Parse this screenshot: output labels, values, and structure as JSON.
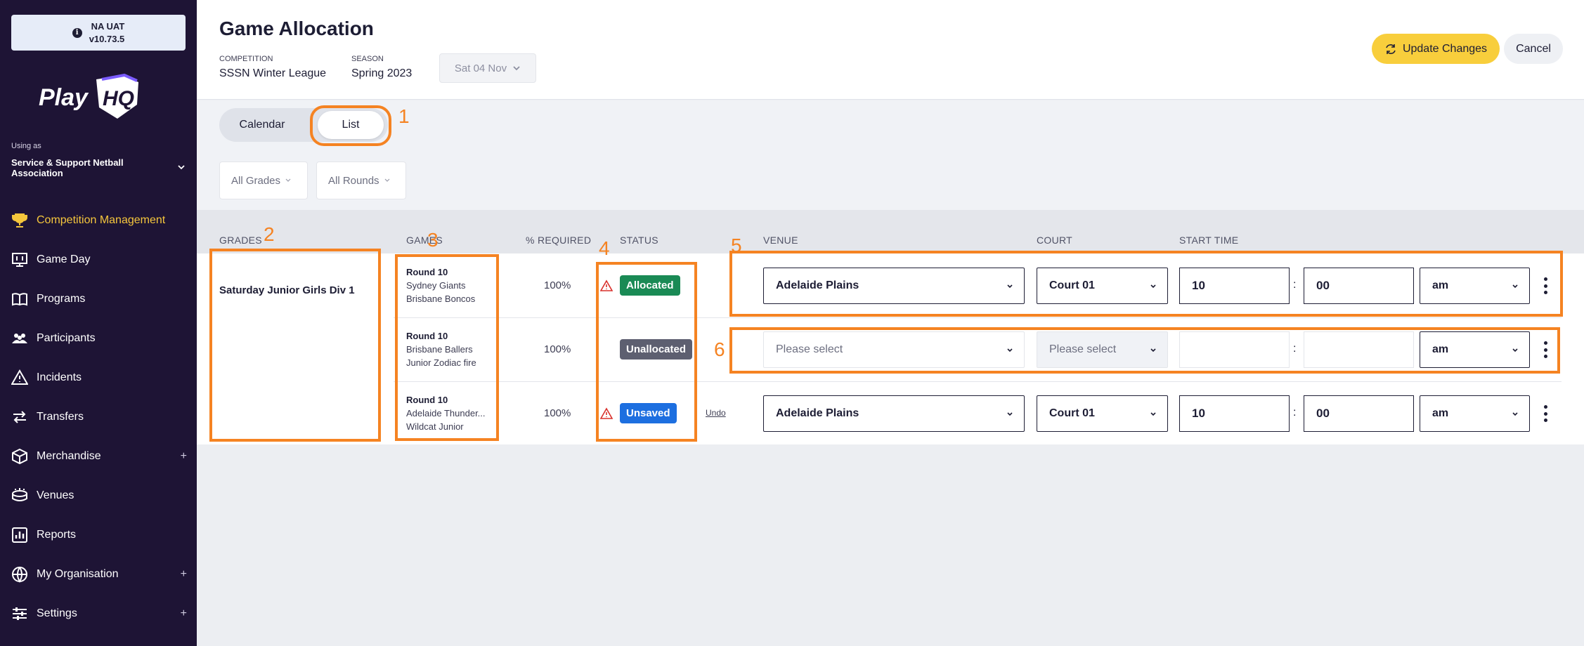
{
  "env": {
    "name": "NA UAT",
    "version": "v10.73.5"
  },
  "org": {
    "using_as": "Using as",
    "name": "Service & Support Netball Association"
  },
  "nav": [
    {
      "label": "Competition Management",
      "icon": "trophy-icon",
      "active": true,
      "plus": ""
    },
    {
      "label": "Game Day",
      "icon": "scoreboard-icon",
      "active": false,
      "plus": ""
    },
    {
      "label": "Programs",
      "icon": "book-icon",
      "active": false,
      "plus": ""
    },
    {
      "label": "Participants",
      "icon": "people-icon",
      "active": false,
      "plus": ""
    },
    {
      "label": "Incidents",
      "icon": "warning-icon",
      "active": false,
      "plus": ""
    },
    {
      "label": "Transfers",
      "icon": "transfer-icon",
      "active": false,
      "plus": ""
    },
    {
      "label": "Merchandise",
      "icon": "box-icon",
      "active": false,
      "plus": "+"
    },
    {
      "label": "Venues",
      "icon": "stadium-icon",
      "active": false,
      "plus": ""
    },
    {
      "label": "Reports",
      "icon": "report-icon",
      "active": false,
      "plus": ""
    },
    {
      "label": "My Organisation",
      "icon": "globe-icon",
      "active": false,
      "plus": "+"
    },
    {
      "label": "Settings",
      "icon": "sliders-icon",
      "active": false,
      "plus": "+"
    }
  ],
  "header": {
    "title": "Game Allocation",
    "competition_label": "COMPETITION",
    "competition": "SSSN Winter League",
    "season_label": "SEASON",
    "season": "Spring 2023",
    "date": "Sat 04 Nov",
    "update_label": "Update Changes",
    "cancel_label": "Cancel"
  },
  "toolbar": {
    "calendar": "Calendar",
    "list": "List",
    "grades_filter": "All Grades",
    "rounds_filter": "All Rounds"
  },
  "table": {
    "headers": {
      "grades": "GRADES",
      "games": "GAMES",
      "required": "% REQUIRED",
      "status": "STATUS",
      "venue": "VENUE",
      "court": "COURT",
      "start_time": "START TIME"
    },
    "grade": "Saturday Junior Girls Div 1",
    "rows": [
      {
        "round": "Round 10",
        "team1": "Sydney Giants",
        "team2": "Brisbane Boncos",
        "required": "100%",
        "status": "Allocated",
        "undo": "",
        "venue": "Adelaide Plains",
        "court": "Court 01",
        "hour": "10",
        "minute": "00",
        "ampm": "am"
      },
      {
        "round": "Round 10",
        "team1": "Brisbane Ballers",
        "team2": "Junior Zodiac fire",
        "required": "100%",
        "status": "Unallocated",
        "undo": "",
        "venue": "Please select",
        "court": "Please select",
        "hour": "",
        "minute": "",
        "ampm": "am"
      },
      {
        "round": "Round 10",
        "team1": "Adelaide Thunder...",
        "team2": "Wildcat Junior",
        "required": "100%",
        "status": "Unsaved",
        "undo": "Undo",
        "venue": "Adelaide Plains",
        "court": "Court 01",
        "hour": "10",
        "minute": "00",
        "ampm": "am"
      }
    ]
  },
  "annotations": [
    "1",
    "2",
    "3",
    "4",
    "5",
    "6"
  ],
  "colors": {
    "sidebar": "#1e1435",
    "accent": "#f5c63c",
    "annotation": "#f58322",
    "allocated": "#1a8a55",
    "unallocated": "#5d5f70",
    "unsaved": "#1d6fe0"
  }
}
